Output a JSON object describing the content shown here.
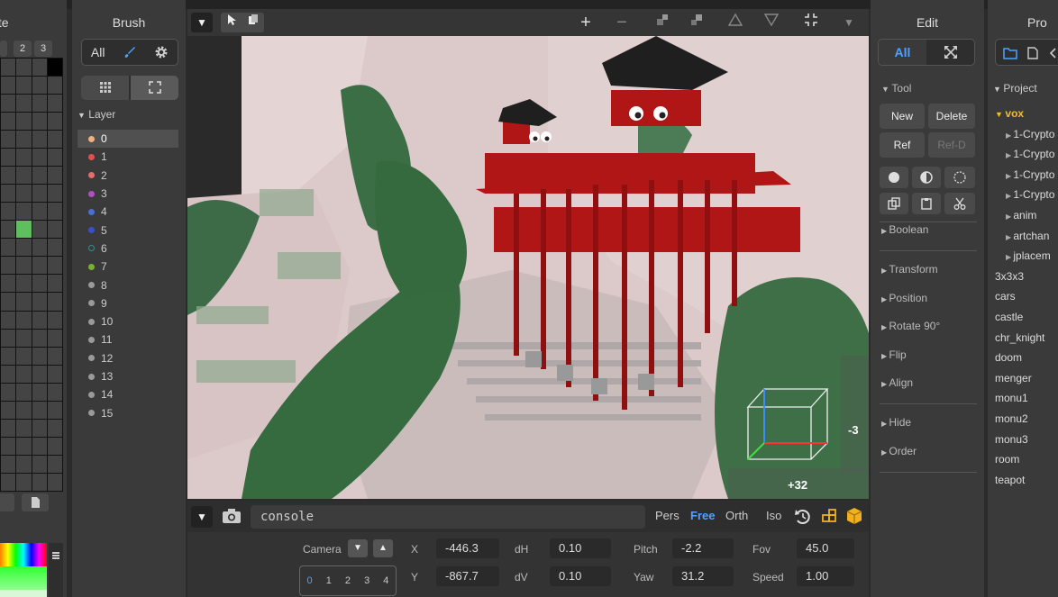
{
  "palette": {
    "title": "tte",
    "tabs": [
      "",
      "2",
      "3"
    ],
    "accent_color": "#5fbf5f"
  },
  "brush": {
    "title": "Brush",
    "mode_all": "All",
    "layer_title": "Layer",
    "layers": [
      {
        "label": "0",
        "color": "#f0b080"
      },
      {
        "label": "1",
        "color": "#e05050"
      },
      {
        "label": "2",
        "color": "#e07070"
      },
      {
        "label": "3",
        "color": "#b050c0"
      },
      {
        "label": "4",
        "color": "#4a6fd0"
      },
      {
        "label": "5",
        "color": "#3a50c8"
      },
      {
        "label": "6",
        "color": "#3a8a8a"
      },
      {
        "label": "7",
        "color": "#7ab030"
      },
      {
        "label": "8",
        "color": "#9a9a9a"
      },
      {
        "label": "9",
        "color": "#9a9a9a"
      },
      {
        "label": "10",
        "color": "#9a9a9a"
      },
      {
        "label": "11",
        "color": "#9a9a9a"
      },
      {
        "label": "12",
        "color": "#9a9a9a"
      },
      {
        "label": "13",
        "color": "#9a9a9a"
      },
      {
        "label": "14",
        "color": "#9a9a9a"
      },
      {
        "label": "15",
        "color": "#9a9a9a"
      }
    ]
  },
  "viewport": {
    "axis_label_right": "-3",
    "axis_label_bottom": "+32"
  },
  "console": {
    "placeholder": "console",
    "projections": [
      "Pers",
      "Free",
      "Orth",
      "Iso"
    ],
    "active_projection": "Free",
    "active_color": "#4da3ff"
  },
  "camera": {
    "label": "Camera",
    "slots": [
      "0",
      "1",
      "2",
      "3",
      "4"
    ],
    "x_label": "X",
    "x_value": "-446.3",
    "y_label": "Y",
    "y_value": "-867.7",
    "dh_label": "dH",
    "dh_value": "0.10",
    "dv_label": "dV",
    "dv_value": "0.10",
    "pitch_label": "Pitch",
    "pitch_value": "-2.2",
    "yaw_label": "Yaw",
    "yaw_value": "31.2",
    "fov_label": "Fov",
    "fov_value": "45.0",
    "speed_label": "Speed",
    "speed_value": "1.00"
  },
  "edit": {
    "title": "Edit",
    "mode_all": "All",
    "tool_section": "Tool",
    "new_label": "New",
    "delete_label": "Delete",
    "ref_label": "Ref",
    "refd_label": "Ref-D",
    "sections": [
      "Boolean",
      "Transform",
      "Position",
      "Rotate 90°",
      "Flip",
      "Align",
      "Hide",
      "Order"
    ]
  },
  "project": {
    "title": "Pro",
    "section": "Project",
    "root": "vox",
    "children": [
      "1-Crypto",
      "1-Crypto",
      "1-Crypto",
      "1-Crypto",
      "anim",
      "artchan",
      "jplacem"
    ],
    "files": [
      "3x3x3",
      "cars",
      "castle",
      "chr_knight",
      "doom",
      "menger",
      "monu1",
      "monu2",
      "monu3",
      "room",
      "teapot"
    ],
    "root_color": "#f0c020"
  }
}
